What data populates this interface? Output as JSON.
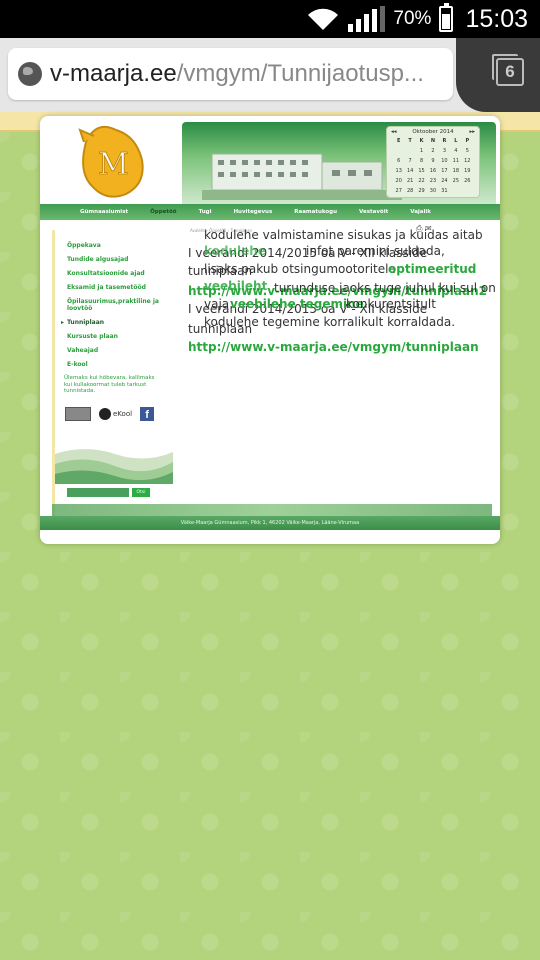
{
  "status_bar": {
    "battery": "70%",
    "time": "15:03"
  },
  "browser": {
    "url_host": "v-maarja.ee",
    "url_path": "/vmgym/Tunnijaotusp...",
    "tab_count": "6"
  },
  "calendar": {
    "title": "Oktoober 2014",
    "weekdays": [
      "E",
      "T",
      "K",
      "N",
      "R",
      "L",
      "P"
    ],
    "days": [
      "",
      "",
      "1",
      "2",
      "3",
      "4",
      "5",
      "6",
      "7",
      "8",
      "9",
      "10",
      "11",
      "12",
      "13",
      "14",
      "15",
      "16",
      "17",
      "18",
      "19",
      "20",
      "21",
      "22",
      "23",
      "24",
      "25",
      "26",
      "27",
      "28",
      "29",
      "30",
      "31",
      "",
      ""
    ]
  },
  "nav": {
    "items": [
      "Gümnaasiumist",
      "Õppetöö",
      "Tugi",
      "Huvitegevus",
      "Raamatukogu",
      "Vestavõit",
      "Vajalik"
    ]
  },
  "sidebar": {
    "items": [
      "Õppekava",
      "Tundide algusajad",
      "Konsultatsioonide ajad",
      "Eksamid ja tasemetööd",
      "Õpilasuurimus,praktiline ja loovtöö",
      "Tunniplaan",
      "Kursuste plaan",
      "Vaheajad",
      "E-kool"
    ],
    "note": "Ülemaks kui hõbevara, kallimaks kui kullakoormat tuleb tarkust tunnistada.",
    "ekool_label": "eKool",
    "search_button": "Otsi"
  },
  "breadcrumb": "Avaleht › Õppetöö › Tunniplaan",
  "overlay_text": {
    "l1": "kodulehe valmistamine sisukas ja kuidas aitab",
    "l2": "I veerandi 2014/2015 oa V - XII klasside",
    "l2_link": "kodulehe",
    "l2_mid": "infot paremini suldada,",
    "l3": "tunniplaan",
    "l4a": "lisaks pakub otsingumootoritele",
    "l4_link": "optimeeritud",
    "l5_link": "http://www.v-maarja.ee/vmgym/tunniplaan2",
    "l5b_link": "veebileht",
    "l5b": "turunduse jaoks tuge juhul kui sul on",
    "l6": "I veerandi 2014/2015 oa V - XII klasside",
    "l6a": "vaja",
    "l6_link": "veebilehe tegemine",
    "l6b": "konkurentsitult",
    "l7": "tunniplaan",
    "l7b": "kodulehe tegemine korralikult korraldada.",
    "l8_link": "http://www.v-maarja.ee/vmgym/tunniplaan"
  },
  "footer": "Väike-Maarja Gümnaasium, Pikk 1, 46202 Väike-Maarja, Lääne-Virumaa",
  "colors": {
    "accent_green": "#2aa83e",
    "page_bg": "#b3d47c",
    "nav_green": "#3f9c52"
  }
}
